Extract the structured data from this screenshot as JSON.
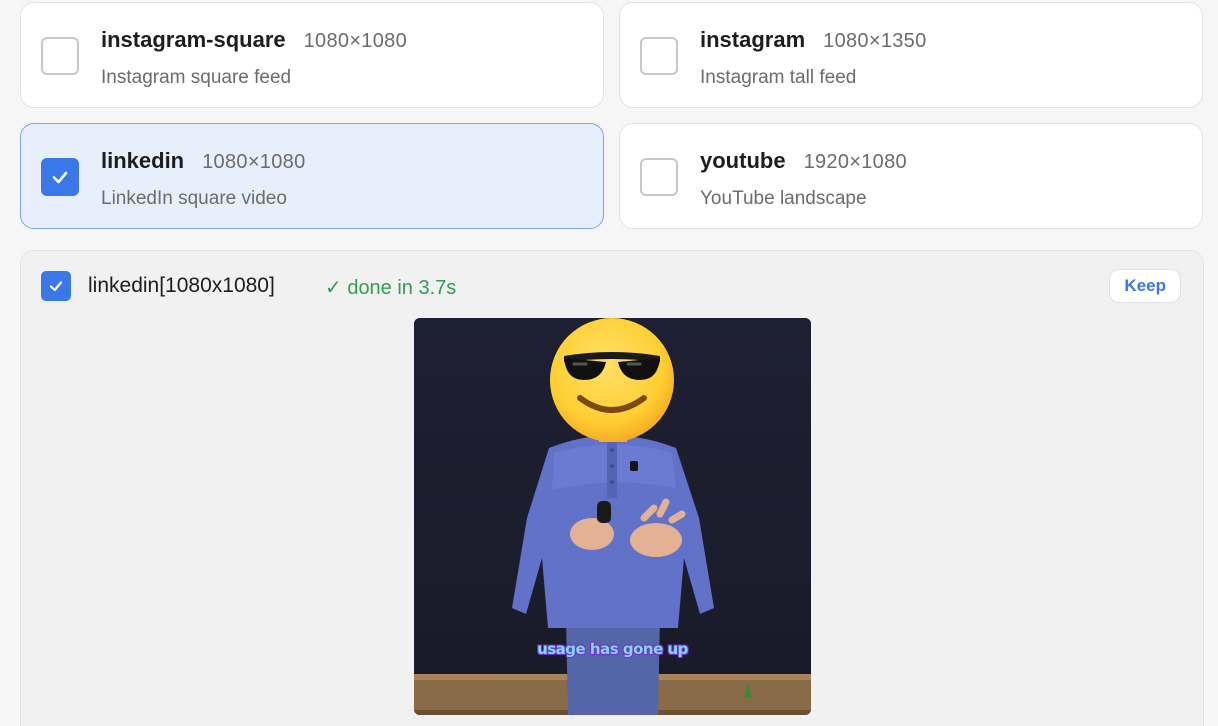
{
  "presets": [
    {
      "name": "instagram-square",
      "dims": "1080×1080",
      "desc": "Instagram square feed",
      "checked": false
    },
    {
      "name": "instagram",
      "dims": "1080×1350",
      "desc": "Instagram tall feed",
      "checked": false
    },
    {
      "name": "linkedin",
      "dims": "1080×1080",
      "desc": "LinkedIn square video",
      "checked": true
    },
    {
      "name": "youtube",
      "dims": "1920×1080",
      "desc": "YouTube landscape",
      "checked": false
    }
  ],
  "result": {
    "title": "linkedin[1080x1080]",
    "status": "✓ done in 3.7s",
    "keep_label": "Keep",
    "caption": "usage has gone up",
    "checked": true
  },
  "colors": {
    "accent": "#3b78e7",
    "success": "#2f9e50",
    "selected_bg": "#e7effd"
  },
  "icons": {
    "checkmark": "checkmark-icon",
    "emoji": "sunglasses-emoji"
  }
}
